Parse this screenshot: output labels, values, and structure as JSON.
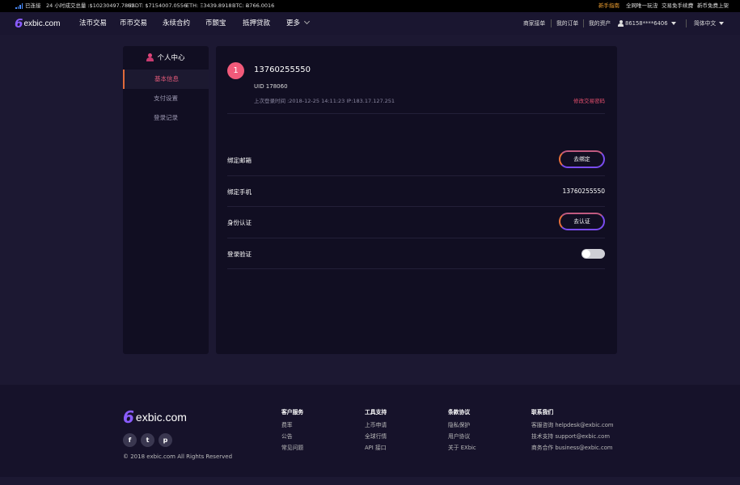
{
  "ticker": {
    "connection": "已连接",
    "volume24h": "24 小时成交总量 :$10230497.7862",
    "usdt": "USDT: $7154007.0556",
    "eth": "ETH: Ξ3439.8918",
    "btc": "BTC: Ƀ766.0016",
    "guide": "新手指南",
    "promo1": "全网唯一玩法",
    "promo2": "交易免手续费",
    "promo3": "新币免费上架",
    "slash": "/"
  },
  "nav": {
    "logo_six": "6",
    "logo_name": "exbic.com",
    "menu": [
      "法币交易",
      "币币交易",
      "永续合约",
      "币颤宝",
      "抵押贷款",
      "更多"
    ],
    "merchant": "商家接单",
    "orders": "我的订单",
    "assets": "我的资产",
    "account": "86158****6406",
    "language": "简体中文"
  },
  "sidebar": {
    "title": "个人中心",
    "items": [
      "基本信息",
      "支付设置",
      "登录记录"
    ]
  },
  "profile": {
    "badge": "1",
    "phone": "13760255550",
    "uid": "UID 178060",
    "last_login": "上次登录时间 :2018-12-25 14:11:23 IP:183.17.127.251",
    "change_password": "修改交易密码"
  },
  "settings": {
    "email_label": "绑定邮箱",
    "email_button": "去绑定",
    "mobile_label": "绑定手机",
    "mobile_value": "13760255550",
    "identity_label": "身份认证",
    "identity_button": "去认证",
    "login_verify_label": "登录验证",
    "login_verify_on": false
  },
  "footer": {
    "logo_six": "6",
    "logo_name": "exbic.com",
    "social": [
      "f",
      "t",
      "p"
    ],
    "copyright": "© 2018 exbic.com All Rights Reserved",
    "columns": [
      {
        "title": "客户服务",
        "links": [
          "费率",
          "公告",
          "常见问题"
        ]
      },
      {
        "title": "工具支持",
        "links": [
          "上币申请",
          "全球行情",
          "API 接口"
        ]
      },
      {
        "title": "条款协议",
        "links": [
          "隐私保护",
          "用户协议",
          "关于 EXbic"
        ]
      },
      {
        "title": "联系我们",
        "links": [
          "客服咨询 helpdesk@exbic.com",
          "技术支持 support@exbic.com",
          "商务合作 business@exbic.com"
        ]
      }
    ]
  },
  "colors": {
    "background": "#1c1832",
    "panel": "#110e22",
    "accent_pink": "#f25a7a",
    "accent_orange": "#e8703a",
    "accent_purple": "#7a4cf0"
  },
  "icons": [
    "signal-icon",
    "user-icon",
    "caret-down-icon",
    "person-icon",
    "facebook-icon",
    "twitter-icon",
    "telegram-icon"
  ]
}
